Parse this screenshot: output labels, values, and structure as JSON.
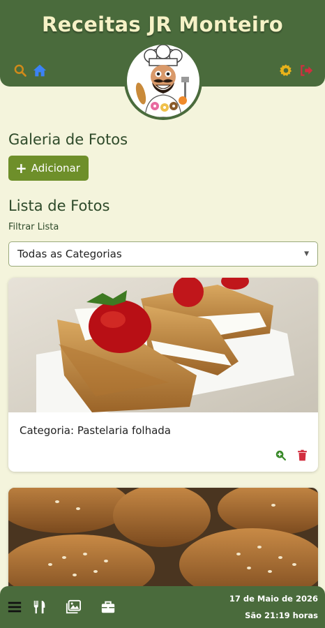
{
  "header": {
    "title": "Receitas JR Monteiro",
    "icons": {
      "search": "search-icon",
      "home": "home-icon",
      "settings": "gear-icon",
      "logout": "logout-icon"
    },
    "logo": "chef-logo"
  },
  "gallery": {
    "title": "Galeria de Fotos",
    "add_label": "Adicionar"
  },
  "list": {
    "title": "Lista de Fotos",
    "filter_label": "Filtrar Lista",
    "filter_selected": "Todas as Categorias"
  },
  "photos": [
    {
      "caption": "Categoria: Pastelaria folhada",
      "actions": [
        "zoom-in-icon",
        "trash-icon"
      ]
    },
    {
      "caption": "",
      "actions": []
    }
  ],
  "footer": {
    "icons": [
      "menu-icon",
      "utensils-icon",
      "images-icon",
      "briefcase-icon"
    ],
    "date": "17 de Maio de 2026",
    "time": "São 21:19 horas"
  },
  "colors": {
    "primary": "#4a6b3c",
    "background": "#f4f4dc",
    "button": "#6e8f2a",
    "delete": "#d22e3f",
    "settings": "#e8b21a",
    "home": "#3b82f6"
  }
}
